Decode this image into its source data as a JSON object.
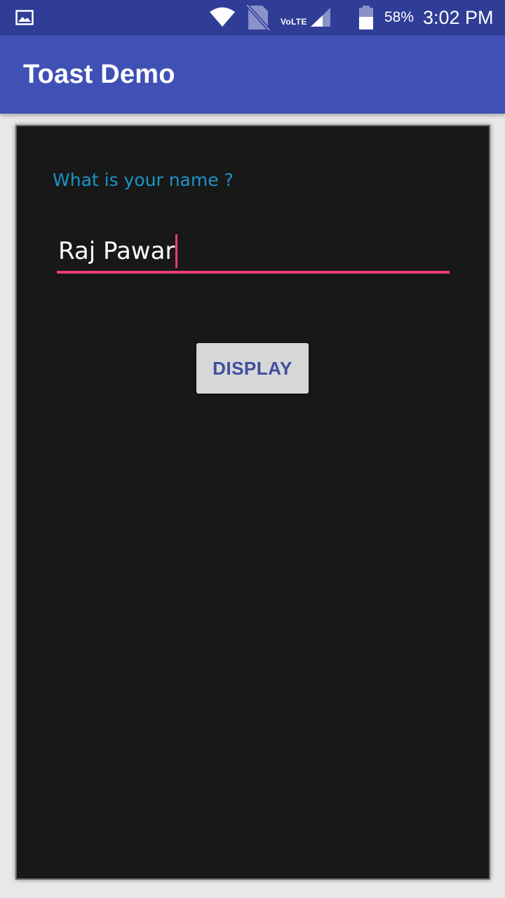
{
  "status_bar": {
    "icons": [
      "gallery-icon",
      "wifi-icon",
      "no-sim-icon",
      "signal-icon",
      "battery-icon"
    ],
    "network_label": "VoLTE",
    "battery_percent": "58%",
    "battery_level": 0.58,
    "time": "3:02 PM"
  },
  "app_bar": {
    "title": "Toast Demo",
    "color": "#3f51b5"
  },
  "form": {
    "prompt": "What is your name ?",
    "name_value": "Raj Pawar",
    "button_label": "DISPLAY"
  },
  "colors": {
    "status_bar": "#2f3d96",
    "accent": "#e53e7a",
    "label": "#1a96c9",
    "panel": "#181818"
  }
}
